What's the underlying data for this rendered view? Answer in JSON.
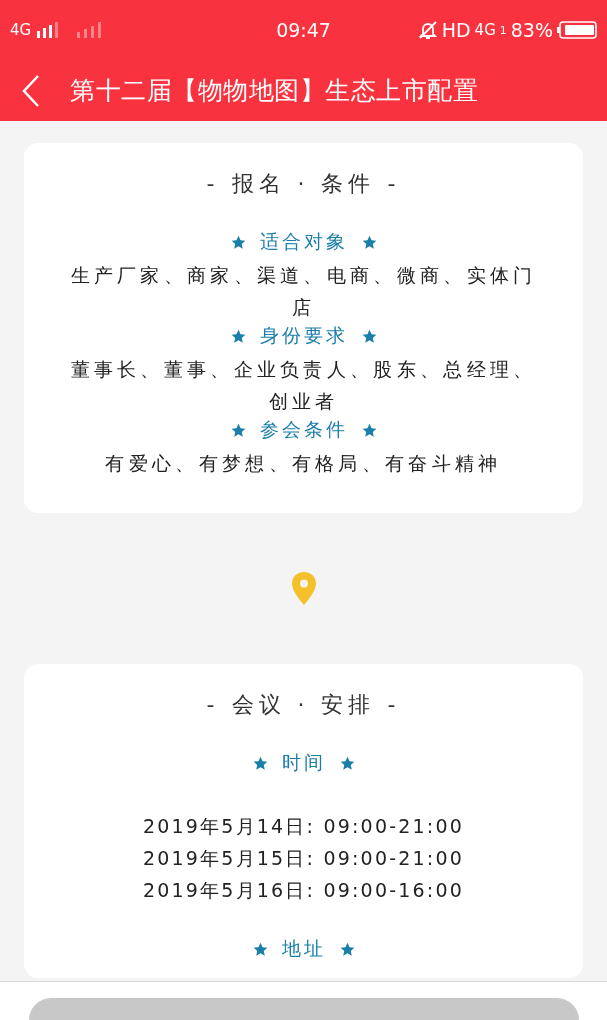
{
  "status_bar": {
    "network": "4G",
    "time": "09:47",
    "hd": "HD",
    "network_2": "4G",
    "sim": "1",
    "battery": "83%"
  },
  "header": {
    "title": "第十二届【物物地图】生态上市配置"
  },
  "cards": [
    {
      "heading": "- 报名 · 条件 -",
      "sections": [
        {
          "label": "适合对象",
          "lines": [
            "生产厂家、商家、渠道、电商、微商、实体门店"
          ]
        },
        {
          "label": "身份要求",
          "lines": [
            "董事长、董事、企业负责人、股东、总经理、创业者"
          ]
        },
        {
          "label": "参会条件",
          "lines": [
            "有爱心、有梦想、有格局、有奋斗精神"
          ]
        }
      ]
    },
    {
      "heading": "- 会议 · 安排 -",
      "sections": [
        {
          "label": "时间",
          "lines": [
            "2019年5月14日: 09:00-21:00",
            "2019年5月15日: 09:00-21:00",
            "2019年5月16日: 09:00-16:00"
          ]
        },
        {
          "label": "地址"
        }
      ]
    }
  ]
}
